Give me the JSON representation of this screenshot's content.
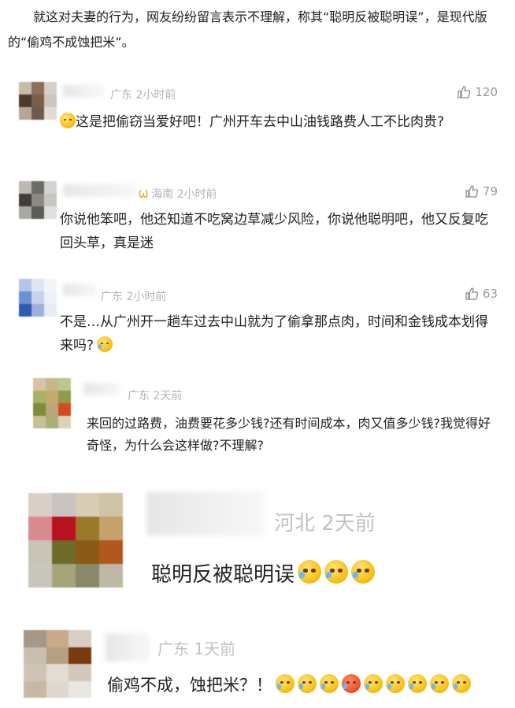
{
  "intro": {
    "text": "就这对夫妻的行为，网友纷纷留言表示不理解，称其“聪明反被聪明误”，是现代版的“偷鸡不成蚀把米”。"
  },
  "comments": [
    {
      "location_time": "广东 2小时前",
      "likes": "120",
      "text": "这是把偷窃当爱好吧！广州开车去中山油钱路费人工不比肉贵?",
      "emoji_prefix": "thinking-emoji",
      "avatar_colors": [
        "#c9b9a8",
        "#8a6f5a",
        "#d8d0c8",
        "#4e3a2c",
        "#7a5e48",
        "#cfc6bd",
        "#b5a697",
        "#6e5a4c",
        "#e2dcd6"
      ]
    },
    {
      "location_time": "海南 2小时前",
      "likes": "79",
      "text": "你说他笨吧，他还知道不吃窝边草减少风险，你说他聪明吧，他又反复吃回头草，真是迷",
      "badge_icon": "vip-icon",
      "avatar_colors": [
        "#bdb8b0",
        "#6b6a64",
        "#d4d2ce",
        "#3f3e3a",
        "#8d8a84",
        "#c8c6c2",
        "#a9a7a2",
        "#5c5b56",
        "#e0dfdc"
      ]
    },
    {
      "location_time": "广东 2小时前",
      "likes": "63",
      "text": "不是…从广州开一趟车过去中山就为了偷拿那点肉，时间和金钱成本划得来吗?",
      "emoji_suffix": "laugh-cry-emoji",
      "avatar_colors": [
        "#b3c6ea",
        "#dfe6f3",
        "#f3f5f9",
        "#6e8fd1",
        "#c5d2ec",
        "#eef1f7",
        "#2f5bb4",
        "#9bb0dd",
        "#e7ebf3"
      ]
    },
    {
      "location_time": "广东 2天前",
      "text": "来回的过路费，油费要花多少钱?还有时间成本，肉又值多少钱?我觉得好奇怪，为什么会这样做?不理解?",
      "avatar_colors": [
        "#d9c2a6",
        "#c7b68a",
        "#b9c98a",
        "#a9b06a",
        "#c9a96a",
        "#8f9b4a",
        "#7e8d3a",
        "#b7a77a",
        "#d24a1e",
        "#c8c09a",
        "#a9b07a",
        "#d9d4b8"
      ]
    },
    {
      "location_time": "河北 2天前",
      "text": "聪明反被聪明误",
      "emoji_count": 3,
      "avatar_colors": [
        "#d9cfc8",
        "#c9c4c0",
        "#d8ccb4",
        "#cfc3a6",
        "#d98a8e",
        "#b8121e",
        "#9a7a2a",
        "#c4a26a",
        "#c9c4b8",
        "#6e6a2a",
        "#8a5a18",
        "#b0581e",
        "#c9c6bc",
        "#a6a47a",
        "#8a8868",
        "#bdb9a6"
      ]
    },
    {
      "location_time": "广东 1天前",
      "text": "偷鸡不成，蚀把米？！",
      "emoji_count": 9,
      "avatar_colors": [
        "#a59886",
        "#c9a98a",
        "#d7cfc4",
        "#c9bfb0",
        "#b6a084",
        "#7a3a10",
        "#cfc4b6",
        "#e2dcd4",
        "#d3c9bb",
        "#c7b9a6",
        "#e0d8ce",
        "#eae6e0"
      ]
    }
  ]
}
